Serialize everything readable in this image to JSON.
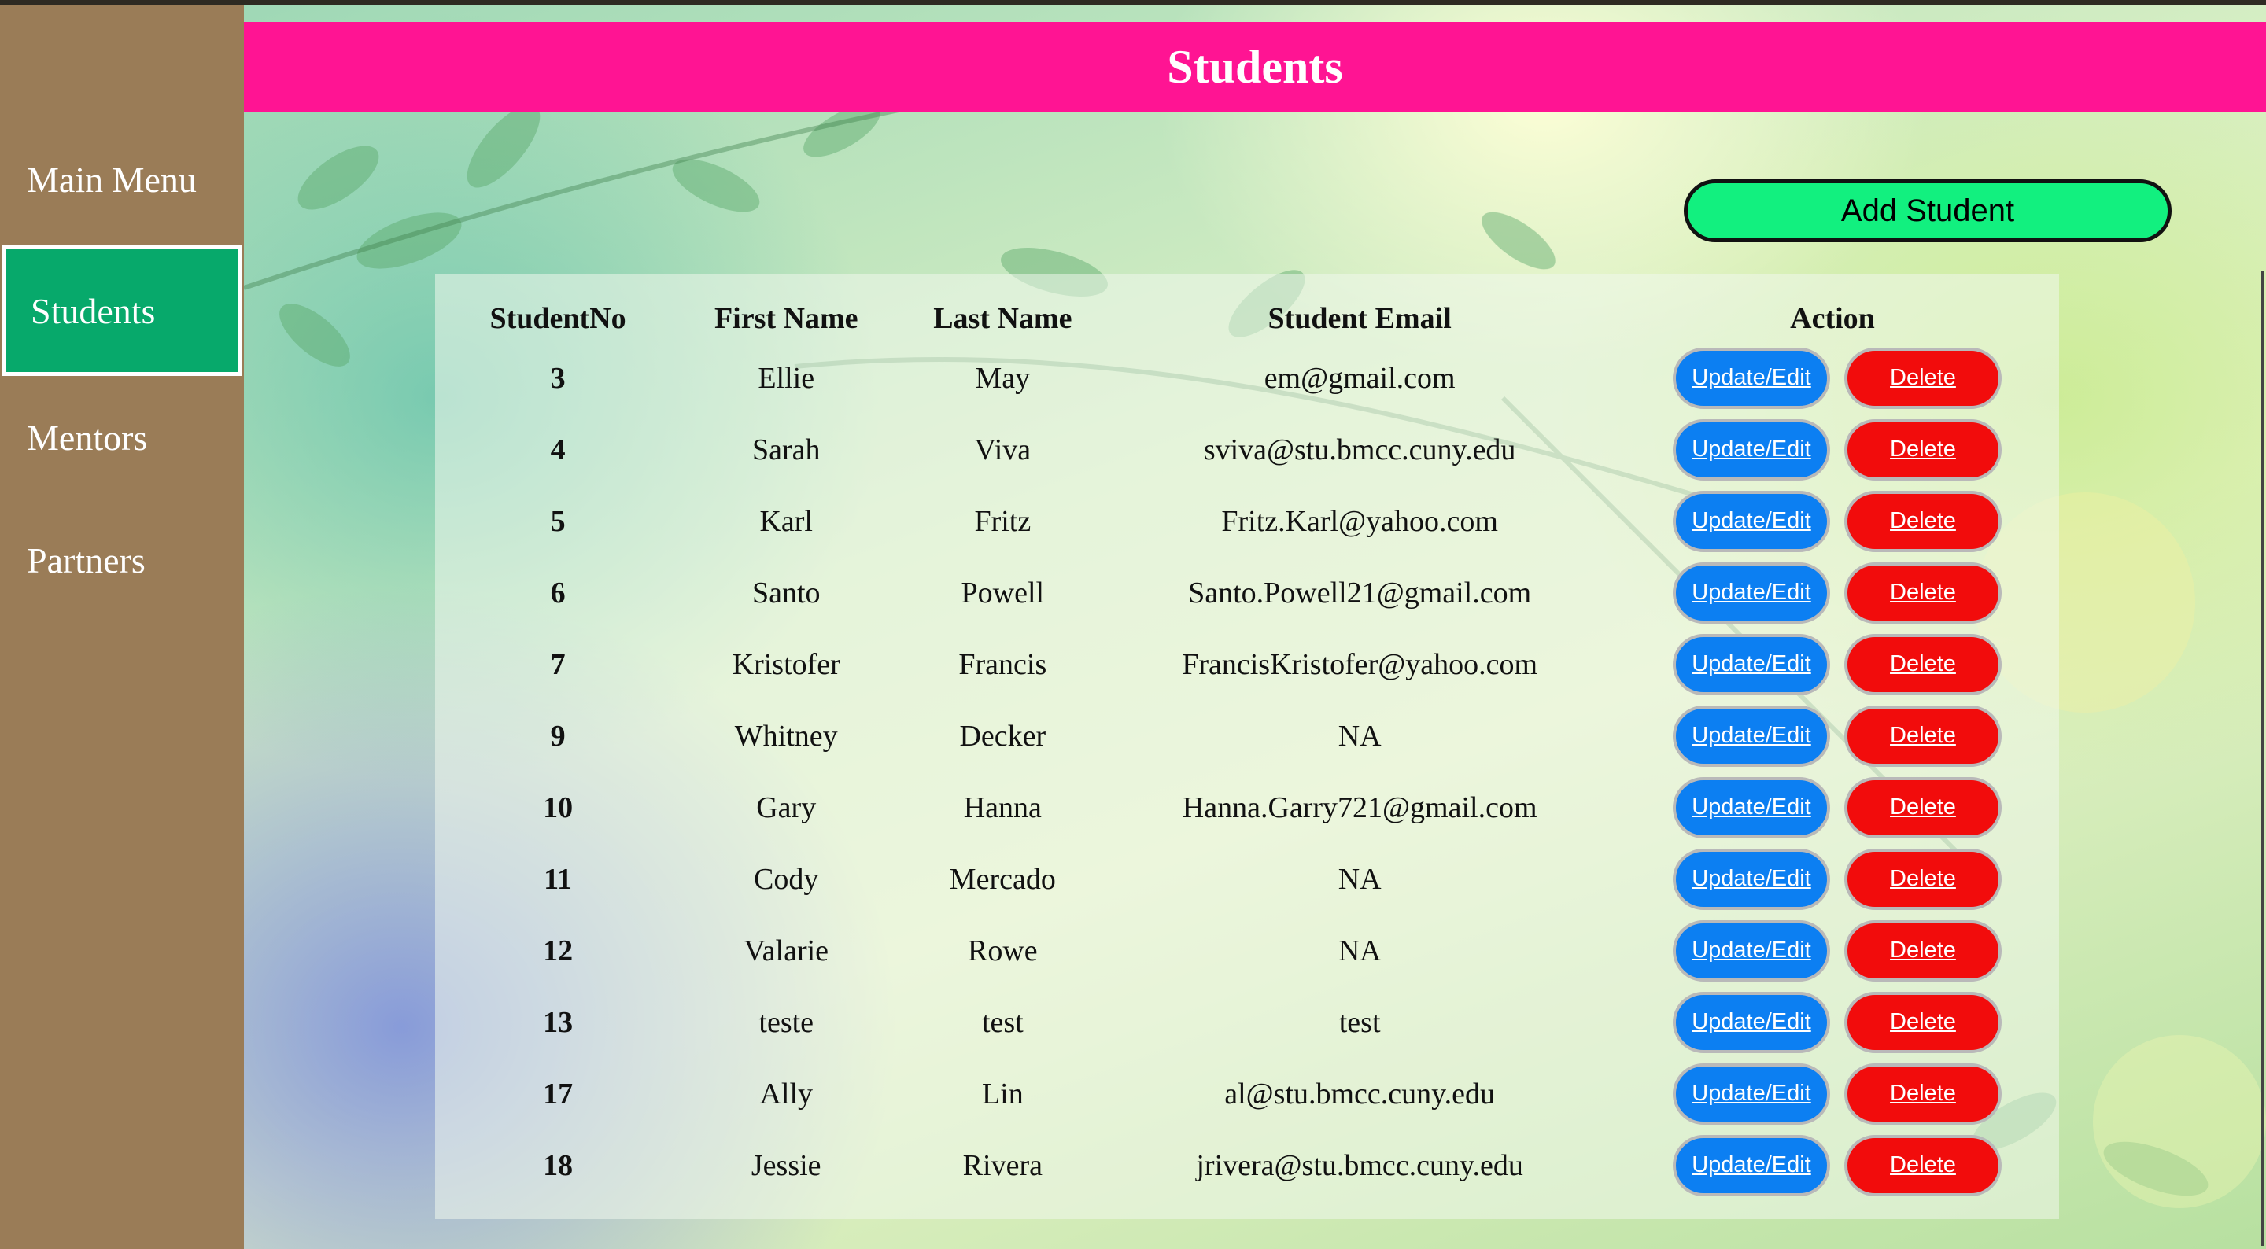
{
  "sidebar": {
    "items": [
      {
        "label": "Main Menu",
        "active": false
      },
      {
        "label": "Students",
        "active": true
      },
      {
        "label": "Mentors",
        "active": false
      },
      {
        "label": "Partners",
        "active": false
      }
    ]
  },
  "header": {
    "title": "Students"
  },
  "toolbar": {
    "add_label": "Add Student"
  },
  "table": {
    "columns": [
      "StudentNo",
      "First Name",
      "Last Name",
      "Student Email",
      "Action"
    ],
    "edit_label": "Update/Edit",
    "delete_label": "Delete",
    "rows": [
      {
        "no": "3",
        "first": "Ellie",
        "last": "May",
        "email": "em@gmail.com"
      },
      {
        "no": "4",
        "first": "Sarah",
        "last": "Viva",
        "email": "sviva@stu.bmcc.cuny.edu"
      },
      {
        "no": "5",
        "first": "Karl",
        "last": "Fritz",
        "email": "Fritz.Karl@yahoo.com"
      },
      {
        "no": "6",
        "first": "Santo",
        "last": "Powell",
        "email": "Santo.Powell21@gmail.com"
      },
      {
        "no": "7",
        "first": "Kristofer",
        "last": "Francis",
        "email": "FrancisKristofer@yahoo.com"
      },
      {
        "no": "9",
        "first": "Whitney",
        "last": "Decker",
        "email": "NA"
      },
      {
        "no": "10",
        "first": "Gary",
        "last": "Hanna",
        "email": "Hanna.Garry721@gmail.com"
      },
      {
        "no": "11",
        "first": "Cody",
        "last": "Mercado",
        "email": "NA"
      },
      {
        "no": "12",
        "first": "Valarie",
        "last": "Rowe",
        "email": "NA"
      },
      {
        "no": "13",
        "first": "teste",
        "last": "test",
        "email": "test"
      },
      {
        "no": "17",
        "first": "Ally",
        "last": "Lin",
        "email": "al@stu.bmcc.cuny.edu"
      },
      {
        "no": "18",
        "first": "Jessie",
        "last": "Rivera",
        "email": "jrivera@stu.bmcc.cuny.edu"
      }
    ]
  },
  "colors": {
    "header": "#ff1493",
    "sidebar": "#9a7c57",
    "sidebar_active": "#07a96b",
    "add_button": "#12f07f",
    "edit_button": "#0c7ff2",
    "delete_button": "#f20c0c"
  }
}
